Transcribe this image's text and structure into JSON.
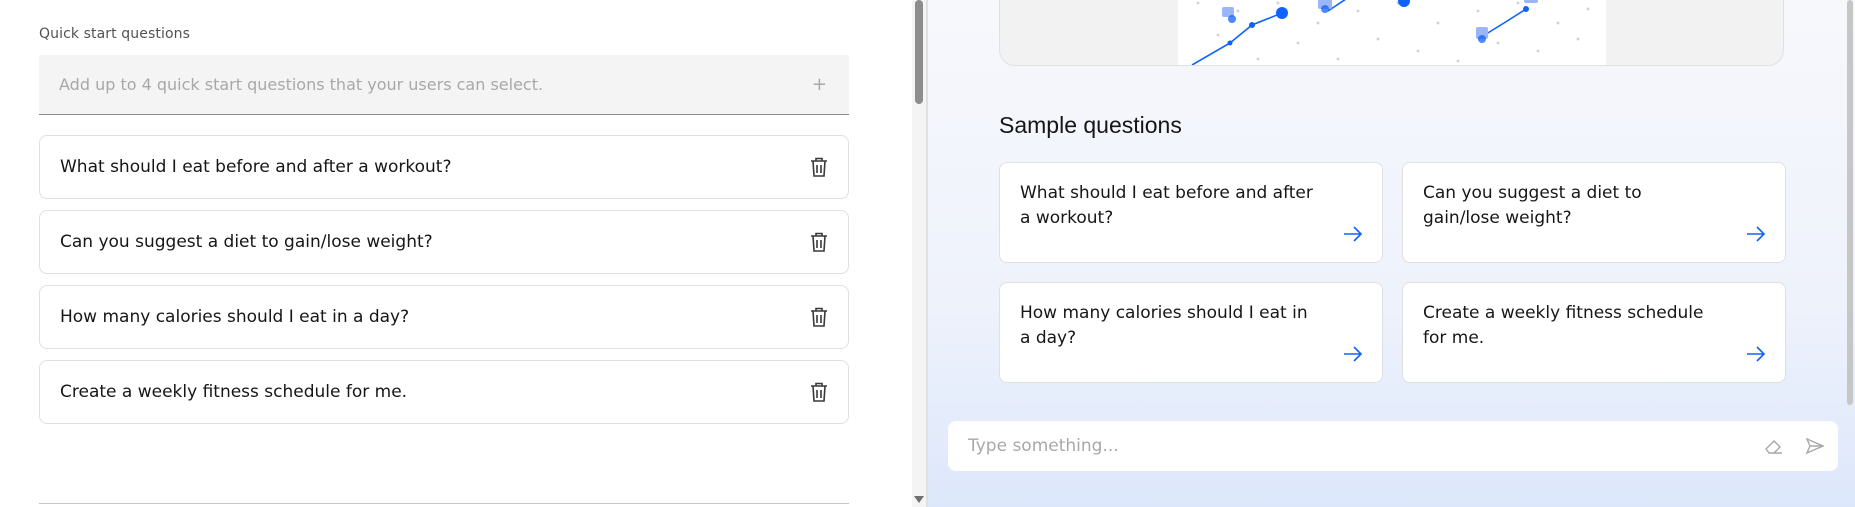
{
  "quick_start": {
    "label": "Quick start questions",
    "input_placeholder": "Add up to 4 quick start questions that your users can select.",
    "add_icon": "plus-icon",
    "delete_icon": "trash-icon",
    "questions": [
      "What should I eat before and after a workout?",
      "Can you suggest a diet to gain/lose weight?",
      "How many calories should I eat in a day?",
      "Create a weekly fitness schedule for me."
    ]
  },
  "preview": {
    "sample_title": "Sample questions",
    "sample_questions": [
      "What should I eat before and after a workout?",
      "Can you suggest a diet to gain/lose weight?",
      "How many calories should I eat in a day?",
      "Create a weekly fitness schedule for me."
    ],
    "card_icon": "arrow-right-icon",
    "chat": {
      "placeholder": "Type something...",
      "clear_icon": "eraser-icon",
      "send_icon": "send-icon"
    }
  },
  "colors": {
    "accent": "#0f62fe",
    "border": "#e0e0e0",
    "input_bg": "#f4f4f4"
  }
}
